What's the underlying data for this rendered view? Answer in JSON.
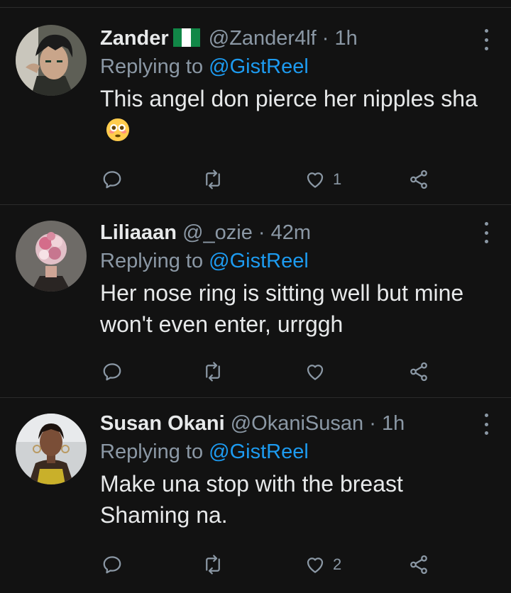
{
  "tweets": [
    {
      "name": "Zander",
      "handle": "@Zander4lf",
      "separator": "·",
      "time": "1h",
      "replying_prefix": "Replying to",
      "replying_handle": "@GistReel",
      "text": "This angel don pierce her nipples sha",
      "emoji": "flushed-face-emoji",
      "flag": "nigeria-flag-icon",
      "reply_count": "",
      "retweet_count": "",
      "like_count": "1",
      "share_count": ""
    },
    {
      "name": "Liliaaan",
      "handle": "@_ozie",
      "separator": "·",
      "time": "42m",
      "replying_prefix": "Replying to",
      "replying_handle": "@GistReel",
      "text": "Her nose ring is sitting well but mine won't even enter, urrggh",
      "reply_count": "",
      "retweet_count": "",
      "like_count": "",
      "share_count": ""
    },
    {
      "name": "Susan Okani",
      "handle": "@OkaniSusan",
      "separator": "·",
      "time": "1h",
      "replying_prefix": "Replying to",
      "replying_handle": "@GistReel",
      "text": "Make una stop with the breast Shaming na.",
      "reply_count": "",
      "retweet_count": "",
      "like_count": "2",
      "share_count": ""
    }
  ],
  "colors": {
    "background": "#121212",
    "text": "#e7e9ea",
    "muted": "#8b98a5",
    "link": "#1d9bf0",
    "divider": "#2b2b2b"
  }
}
